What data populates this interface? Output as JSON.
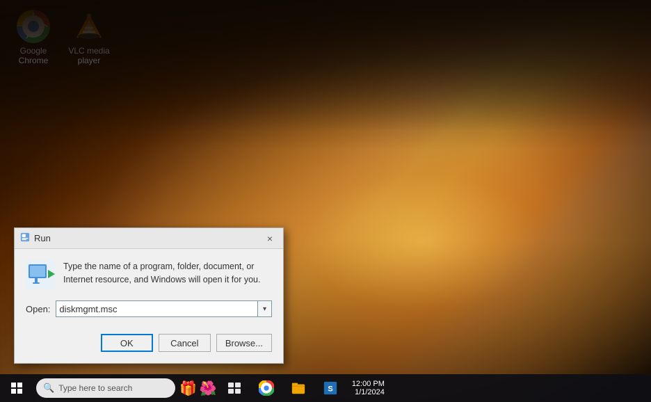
{
  "desktop": {
    "background": "forest autumn sunset"
  },
  "icons": [
    {
      "id": "google-chrome",
      "label": "Google Chrome",
      "type": "chrome"
    },
    {
      "id": "vlc-media-player",
      "label": "VLC media player",
      "type": "vlc"
    }
  ],
  "run_dialog": {
    "title": "Run",
    "description": "Type the name of a program, folder, document, or Internet resource, and Windows will open it for you.",
    "open_label": "Open:",
    "input_value": "diskmgmt.msc",
    "ok_label": "OK",
    "cancel_label": "Cancel",
    "browse_label": "Browse...",
    "close_label": "×"
  },
  "taskbar": {
    "search_placeholder": "Type here to search",
    "start_label": "Start"
  }
}
